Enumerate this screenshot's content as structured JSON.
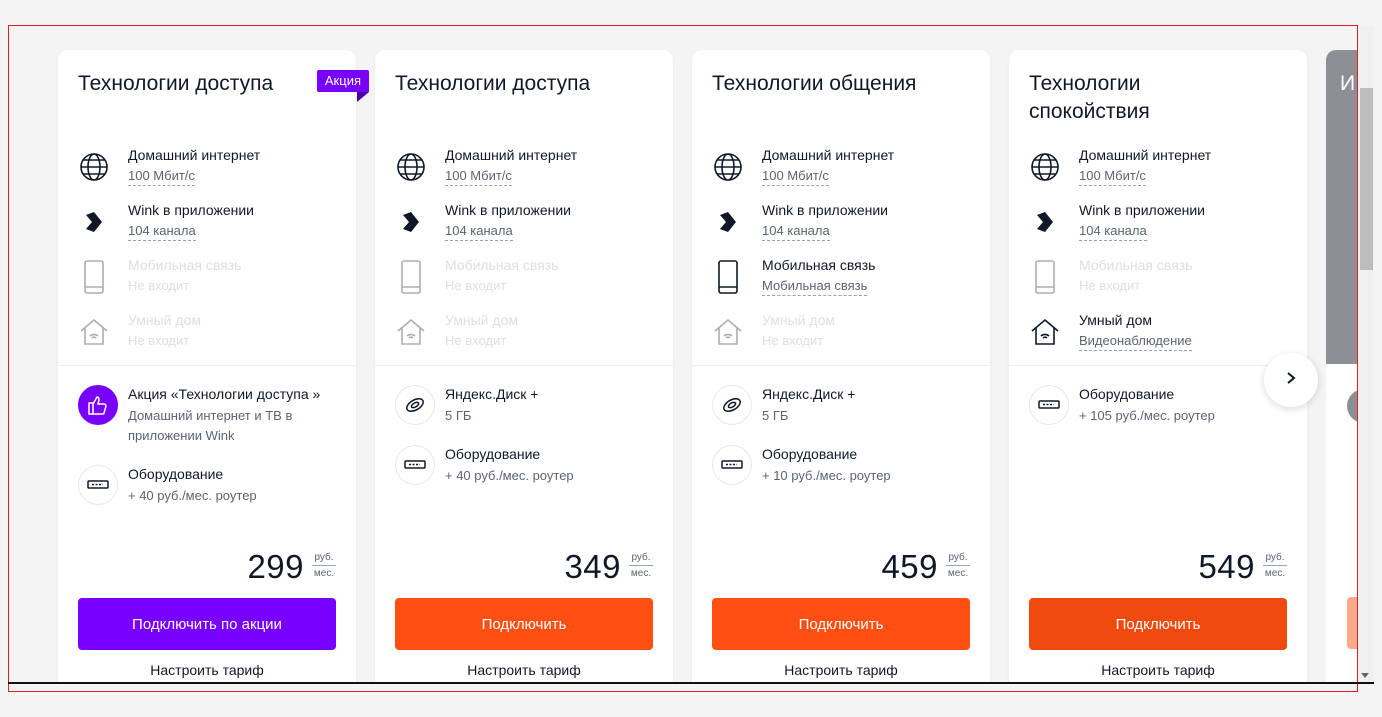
{
  "cards": [
    {
      "title": "Технологии доступа",
      "badge": "Акция",
      "features": [
        {
          "name": "Домашний интернет",
          "value": "100 Мбит/с",
          "icon": "globe-icon"
        },
        {
          "name": "Wink в приложении",
          "value": "104 канала",
          "icon": "wink-icon"
        },
        {
          "name": "Мобильная связь",
          "value": "Не входит",
          "icon": "phone-icon"
        },
        {
          "name": "Умный дом",
          "value": "Не входит",
          "icon": "house-icon"
        }
      ],
      "options": [
        {
          "title": "Акция «Технологии доступа »",
          "text": "Домашний интернет и ТВ в приложении Wink",
          "icon": "thumbs-up-icon"
        },
        {
          "title": "Оборудование",
          "text": "+ 40 руб./мес. роутер",
          "icon": "router-icon"
        }
      ],
      "price": "299",
      "currency": "руб.",
      "period": "мес.",
      "cta": "Подключить по акции",
      "configure": "Настроить тариф"
    },
    {
      "title": "Технологии доступа",
      "features": [
        {
          "name": "Домашний интернет",
          "value": "100 Мбит/с",
          "icon": "globe-icon"
        },
        {
          "name": "Wink в приложении",
          "value": "104 канала",
          "icon": "wink-icon"
        },
        {
          "name": "Мобильная связь",
          "value": "Не входит",
          "icon": "phone-icon"
        },
        {
          "name": "Умный дом",
          "value": "Не входит",
          "icon": "house-icon"
        }
      ],
      "options": [
        {
          "title": "Яндекс.Диск +",
          "text": "5 ГБ",
          "icon": "disk-icon"
        },
        {
          "title": "Оборудование",
          "text": "+ 40 руб./мес. роутер",
          "icon": "router-icon"
        }
      ],
      "price": "349",
      "currency": "руб.",
      "period": "мес.",
      "cta": "Подключить",
      "configure": "Настроить тариф"
    },
    {
      "title": "Технологии общения",
      "features": [
        {
          "name": "Домашний интернет",
          "value": "100 Мбит/с",
          "icon": "globe-icon"
        },
        {
          "name": "Wink в приложении",
          "value": "104 канала",
          "icon": "wink-icon"
        },
        {
          "name": "Мобильная связь",
          "value": "Мобильная связь",
          "icon": "phone-icon"
        },
        {
          "name": "Умный дом",
          "value": "Не входит",
          "icon": "house-icon"
        }
      ],
      "options": [
        {
          "title": "Яндекс.Диск +",
          "text": "5 ГБ",
          "icon": "disk-icon"
        },
        {
          "title": "Оборудование",
          "text": "+ 10 руб./мес. роутер",
          "icon": "router-icon"
        }
      ],
      "price": "459",
      "currency": "руб.",
      "period": "мес.",
      "cta": "Подключить",
      "configure": "Настроить тариф"
    },
    {
      "title": "Технологии спокойствия",
      "features": [
        {
          "name": "Домашний интернет",
          "value": "100 Мбит/с",
          "icon": "globe-icon"
        },
        {
          "name": "Wink в приложении",
          "value": "104 канала",
          "icon": "wink-icon"
        },
        {
          "name": "Мобильная связь",
          "value": "Не входит",
          "icon": "phone-icon"
        },
        {
          "name": "Умный дом",
          "value": "Видеонаблюдение",
          "icon": "house-icon"
        }
      ],
      "options": [
        {
          "title": "Оборудование",
          "text": "+ 105 руб./мес. роутер",
          "icon": "router-icon"
        }
      ],
      "price": "549",
      "currency": "руб.",
      "period": "мес.",
      "cta": "Подключить",
      "configure": "Настроить тариф"
    }
  ],
  "peek_card": {
    "title_fragment": "И"
  },
  "colors": {
    "promo": "#7700ff",
    "cta": "#ff4f12",
    "text": "#101828",
    "muted": "#5b6473",
    "disabled": "#dcdfe4"
  }
}
